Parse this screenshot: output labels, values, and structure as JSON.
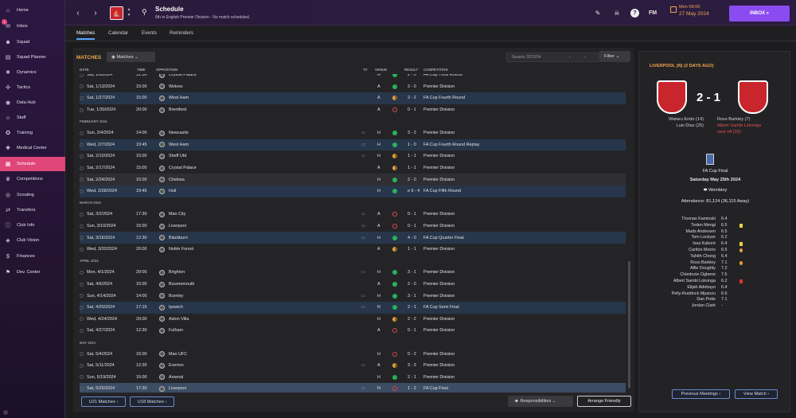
{
  "sidebar": {
    "items": [
      {
        "label": "Home",
        "icon": "⌂"
      },
      {
        "label": "Inbox",
        "icon": "✉"
      },
      {
        "label": "Squad",
        "icon": "☻"
      },
      {
        "label": "Squad Planner",
        "icon": "▤"
      },
      {
        "label": "Dynamics",
        "icon": "❖"
      },
      {
        "label": "Tactics",
        "icon": "✣"
      },
      {
        "label": "Data Hub",
        "icon": "◉"
      },
      {
        "label": "Staff",
        "icon": "☺"
      },
      {
        "label": "Training",
        "icon": "✪"
      },
      {
        "label": "Medical Center",
        "icon": "✚"
      },
      {
        "label": "Schedule",
        "icon": "▦"
      },
      {
        "label": "Competitions",
        "icon": "♛"
      },
      {
        "label": "Scouting",
        "icon": "◎"
      },
      {
        "label": "Transfers",
        "icon": "⇄"
      },
      {
        "label": "Club Info",
        "icon": "ⓘ"
      },
      {
        "label": "Club Vision",
        "icon": "◈"
      },
      {
        "label": "Finances",
        "icon": "$"
      },
      {
        "label": "Dev. Center",
        "icon": "⚑"
      }
    ],
    "badge": "1"
  },
  "header": {
    "title": "Schedule",
    "subtitle": "6th in English Premier Division - No match scheduled.",
    "day": "Mon 09:00",
    "date": "27 May 2024",
    "inbox": "INBOX",
    "fm": "FM"
  },
  "tabs": [
    "Matches",
    "Calendar",
    "Events",
    "Reminders"
  ],
  "matches": {
    "title": "MATCHES",
    "dropdown": "Matches",
    "season": "Season 2023/24",
    "filter": "Filter",
    "columns": [
      "DATE",
      "TIME",
      "OPPOSITION",
      "TV",
      "VENUE",
      "RESULT",
      "COMPETITION"
    ],
    "rows": [
      {
        "d": "Sat, 1/6/2024",
        "t": "12:30",
        "o": "Crystal Palace",
        "v": "H",
        "r": "2 - 0",
        "c": "FA Cup Third Round",
        "res": "w"
      },
      {
        "d": "Sat, 1/13/2024",
        "t": "15:00",
        "o": "Wolves",
        "v": "A",
        "r": "2 - 0",
        "c": "Premier Division",
        "res": "w"
      },
      {
        "d": "Sat, 1/27/2024",
        "t": "15:00",
        "o": "West Ham",
        "v": "A",
        "r": "2 - 2",
        "c": "FA Cup Fourth Round",
        "res": "d",
        "alt": true
      },
      {
        "d": "Tue, 1/30/2024",
        "t": "20:00",
        "o": "Brentford",
        "v": "A",
        "r": "0 - 1",
        "c": "Premier Division",
        "res": "l"
      },
      {
        "month": "FEBRUARY 2024"
      },
      {
        "d": "Sun, 2/4/2024",
        "t": "14:00",
        "o": "Newcastle",
        "v": "H",
        "r": "3 - 2",
        "c": "Premier Division",
        "res": "w",
        "tv": true
      },
      {
        "d": "Wed, 2/7/2024",
        "t": "19:45",
        "o": "West Ham",
        "v": "H",
        "r": "1 - 0",
        "c": "FA Cup Fourth Round Replay",
        "res": "w",
        "alt": true,
        "tv": true
      },
      {
        "d": "Sat, 2/10/2024",
        "t": "15:00",
        "o": "Sheff Utd",
        "v": "H",
        "r": "1 - 1",
        "c": "Premier Division",
        "res": "d",
        "tv": true
      },
      {
        "d": "Sat, 2/17/2024",
        "t": "15:00",
        "o": "Crystal Palace",
        "v": "A",
        "r": "1 - 1",
        "c": "Premier Division",
        "res": "d"
      },
      {
        "d": "Sat, 2/24/2024",
        "t": "15:00",
        "o": "Chelsea",
        "v": "H",
        "r": "2 - 0",
        "c": "Premier Division",
        "res": "w",
        "alt2": true
      },
      {
        "d": "Wed, 2/28/2024",
        "t": "19:45",
        "o": "Hull",
        "v": "H",
        "r": "e 6 - 4",
        "c": "FA Cup Fifth Round",
        "res": "w",
        "alt": true
      },
      {
        "month": "MARCH 2024"
      },
      {
        "d": "Sat, 3/2/2024",
        "t": "17:30",
        "o": "Man City",
        "v": "A",
        "r": "0 - 1",
        "c": "Premier Division",
        "res": "l",
        "tv": true
      },
      {
        "d": "Sun, 3/10/2024",
        "t": "15:00",
        "o": "Liverpool",
        "v": "A",
        "r": "0 - 1",
        "c": "Premier Division",
        "res": "l",
        "tv": true
      },
      {
        "d": "Sat, 3/16/2024",
        "t": "12:30",
        "o": "Blackburn",
        "v": "H",
        "r": "4 - 0",
        "c": "FA Cup Quarter Final",
        "res": "w",
        "alt": true,
        "tv": true
      },
      {
        "d": "Wed, 3/20/2024",
        "t": "20:00",
        "o": "Nottm Forest",
        "v": "A",
        "r": "1 - 1",
        "c": "Premier Division",
        "res": "d"
      },
      {
        "month": "APRIL 2024"
      },
      {
        "d": "Mon, 4/1/2024",
        "t": "20:00",
        "o": "Brighton",
        "v": "H",
        "r": "3 - 1",
        "c": "Premier Division",
        "res": "w",
        "tv": true
      },
      {
        "d": "Sat, 4/6/2024",
        "t": "15:00",
        "o": "Bournemouth",
        "v": "A",
        "r": "2 - 0",
        "c": "Premier Division",
        "res": "w"
      },
      {
        "d": "Sun, 4/14/2024",
        "t": "14:00",
        "o": "Burnley",
        "v": "H",
        "r": "3 - 1",
        "c": "Premier Division",
        "res": "w",
        "tv": true
      },
      {
        "d": "Sat, 4/20/2024",
        "t": "17:15",
        "o": "Ipswich",
        "v": "N",
        "r": "2 - 1",
        "c": "FA Cup Semi Final",
        "res": "w",
        "alt": true,
        "tv": true
      },
      {
        "d": "Wed, 4/24/2024",
        "t": "20:00",
        "o": "Aston Villa",
        "v": "H",
        "r": "2 - 2",
        "c": "Premier Division",
        "res": "d"
      },
      {
        "d": "Sat, 4/27/2024",
        "t": "12:30",
        "o": "Fulham",
        "v": "A",
        "r": "0 - 1",
        "c": "Premier Division",
        "res": "l"
      },
      {
        "month": "MAY 2024"
      },
      {
        "d": "Sat, 5/4/2024",
        "t": "15:00",
        "o": "Man UFC",
        "v": "H",
        "r": "0 - 2",
        "c": "Premier Division",
        "res": "l"
      },
      {
        "d": "Sat, 5/11/2024",
        "t": "12:30",
        "o": "Everton",
        "v": "A",
        "r": "3 - 3",
        "c": "Premier Division",
        "res": "d",
        "tv": true
      },
      {
        "d": "Sun, 5/19/2024",
        "t": "15:00",
        "o": "Arsenal",
        "v": "H",
        "r": "2 - 1",
        "c": "Premier Division",
        "res": "w"
      },
      {
        "d": "Sat, 5/25/2024",
        "t": "17:30",
        "o": "Liverpool",
        "v": "N",
        "r": "1 - 2",
        "c": "FA Cup Final",
        "res": "l",
        "sel": true,
        "tv": true
      }
    ]
  },
  "buttons": {
    "u21": "U21 Matches",
    "u18": "U18 Matches",
    "responsibilities": "Responsibilities",
    "arrange": "Arrange Friendly",
    "prev": "Previous Meetings",
    "view": "View Match"
  },
  "report": {
    "header": "LIVERPOOL (N) (2 DAYS AGO)",
    "score": "2 - 1",
    "left_scorers": [
      "Wataru Endo (14)",
      "Luis Diaz (25)"
    ],
    "right_scorers": [
      "Ross Barkley (7)"
    ],
    "red": "Albert Sambi Lokonga",
    "red2": "sent off (20)",
    "competition": "FA Cup Final",
    "date": "Saturday May 25th 2024",
    "venue": "Wembley",
    "attendance": "Attendance: 81,124 (36,115 Away)",
    "lineup": [
      {
        "n": "Thomas Kaminski",
        "r": "6.4",
        "e": ""
      },
      {
        "n": "Teden Mengi",
        "r": "6.5",
        "e": "y"
      },
      {
        "n": "Mads Andersen",
        "r": "6.5",
        "e": ""
      },
      {
        "n": "Tom Lockyer",
        "r": "6.2",
        "e": ""
      },
      {
        "n": "Issa Kaboré",
        "r": "6.4",
        "e": "y"
      },
      {
        "n": "Carlton Morris",
        "r": "6.5",
        "e": "s"
      },
      {
        "n": "Tahith Chong",
        "r": "6.4",
        "e": ""
      },
      {
        "n": "Ross Barkley",
        "r": "7.1",
        "e": "g"
      },
      {
        "n": "Alfie Doughty",
        "r": "7.2",
        "e": ""
      },
      {
        "n": "Chiedozie Ogbene",
        "r": "7.5",
        "e": ""
      },
      {
        "n": "Albert Sambi Lokonga",
        "r": "6.2",
        "e": "r"
      },
      {
        "n": "Elijah Adebayo",
        "r": "6.4",
        "e": ""
      },
      {
        "n": "Pelly-Ruddock Mpanzu",
        "r": "6.6",
        "e": ""
      },
      {
        "n": "Dan Potts",
        "r": "7.1",
        "e": ""
      },
      {
        "n": "Jordan Clark",
        "r": "-",
        "e": ""
      }
    ]
  },
  "colors": {
    "accent": "#f2a74b",
    "active": "#e0467a",
    "inbox": "#8a4cf0",
    "win": "#27b35c",
    "draw": "#e8a33a",
    "loss": "#e04848"
  }
}
